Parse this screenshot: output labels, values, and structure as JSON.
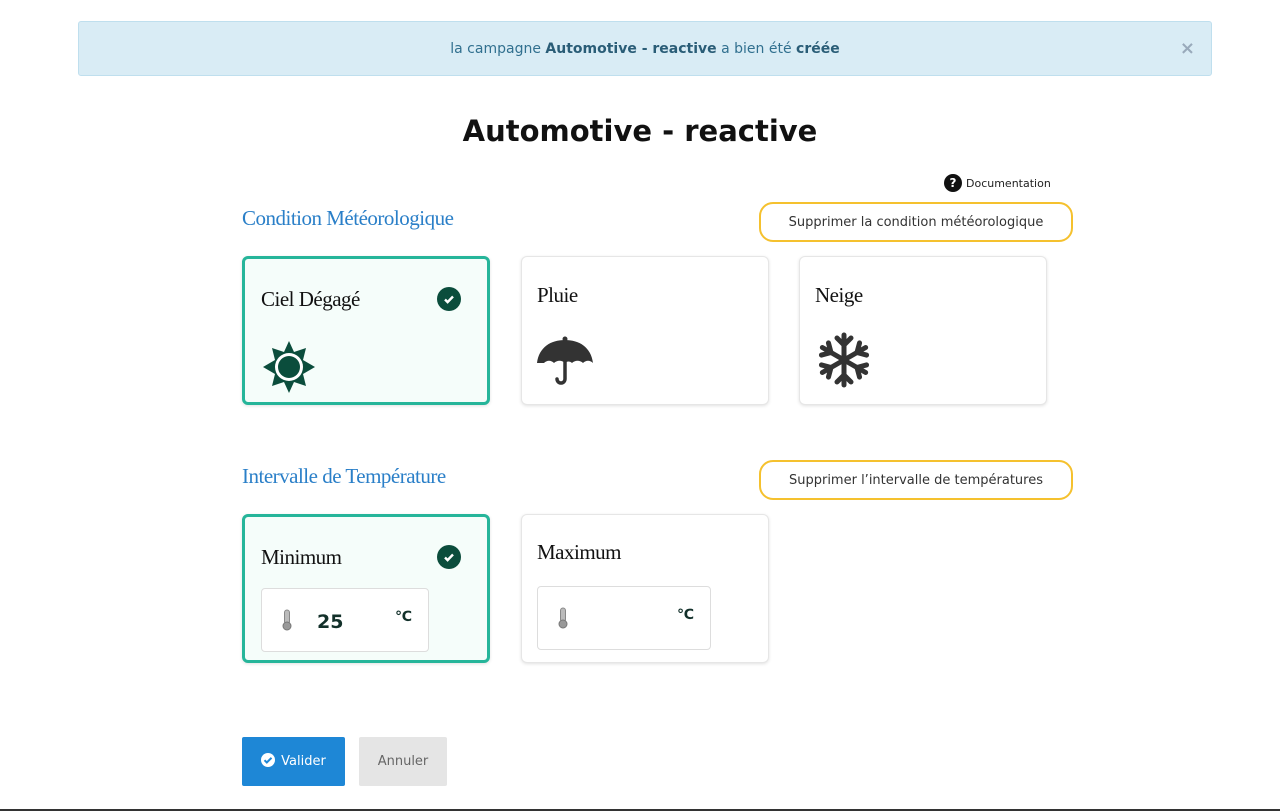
{
  "alert": {
    "prefix": "la campagne",
    "campaign": "Automotive - reactive",
    "middle": "a bien été",
    "status": "créée",
    "close": "×"
  },
  "page_title": "Automotive - reactive",
  "documentation": "Documentation",
  "weather": {
    "title": "Condition Météorologique",
    "delete_label": "Supprimer la condition météorologique",
    "options": [
      {
        "label": "Ciel Dégagé",
        "icon": "sun-icon",
        "selected": true
      },
      {
        "label": "Pluie",
        "icon": "umbrella-icon",
        "selected": false
      },
      {
        "label": "Neige",
        "icon": "snowflake-icon",
        "selected": false
      }
    ]
  },
  "temperature": {
    "title": "Intervalle de Température",
    "delete_label": "Supprimer l’intervalle de températures",
    "minimum": {
      "label": "Minimum",
      "value": "25",
      "unit": "℃",
      "selected": true
    },
    "maximum": {
      "label": "Maximum",
      "value": "",
      "unit": "℃",
      "selected": false
    }
  },
  "buttons": {
    "submit": "Valider",
    "cancel": "Annuler"
  },
  "colors": {
    "accent": "#26b59a",
    "primary": "#1e87d6",
    "warning": "#f5c12e",
    "title": "#2a7fc8"
  }
}
